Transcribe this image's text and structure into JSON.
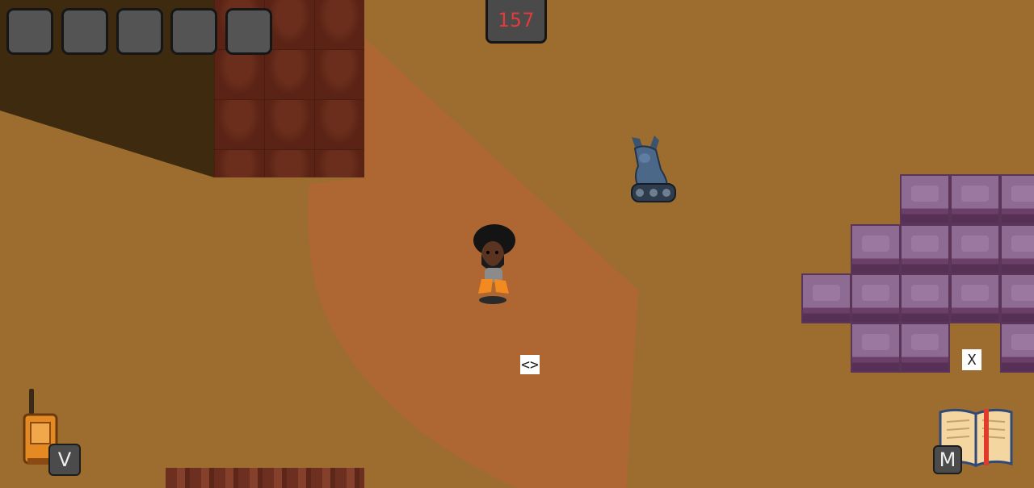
{
  "hud": {
    "inventory_slots": [
      "",
      "",
      "",
      "",
      ""
    ],
    "timer_value": "157",
    "timer_color": "#e43a3a"
  },
  "hotkeys": {
    "radio_key": "V",
    "map_key": "M"
  },
  "markers": {
    "interact_marker": "<>",
    "exit_marker": "X"
  },
  "icons": {
    "radio": "walkie-talkie-icon",
    "journal": "open-book-icon"
  },
  "colors": {
    "sand": "#9d6d30",
    "rock": "#5a2315",
    "vision_cone": "#d25a3c",
    "crystal_block": "#8e6b93"
  }
}
